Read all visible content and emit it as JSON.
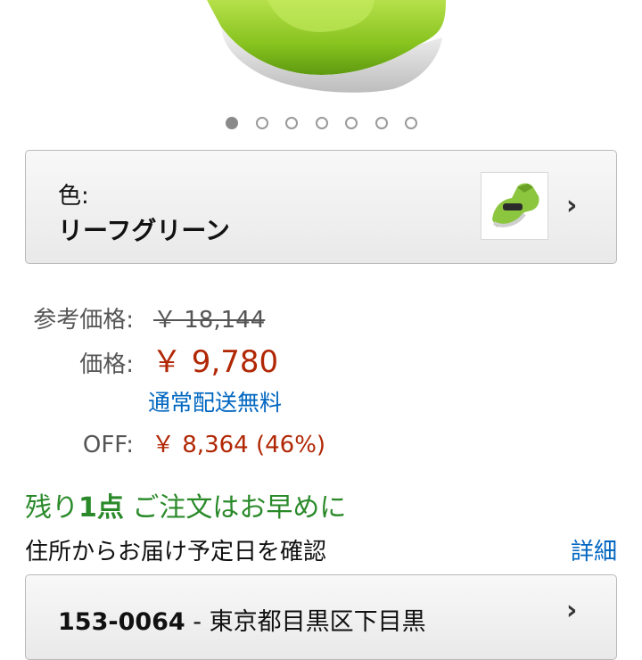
{
  "product_image": {
    "icon": "vacuum-cleaner-icon",
    "color": "#8cc63f"
  },
  "carousel": {
    "count": 7,
    "active_index": 0
  },
  "variant": {
    "label": "色:",
    "value": "リーフグリーン",
    "thumb_icon": "vacuum-thumbnail-icon"
  },
  "pricing": {
    "list_price_label": "参考価格:",
    "list_price": "￥ 18,144",
    "price_label": "価格:",
    "price": "￥ 9,780",
    "shipping": "通常配送無料",
    "off_label": "OFF:",
    "off_value": "￥ 8,364 (46%)"
  },
  "stock": {
    "prefix": "残り",
    "count": "1点",
    "suffix": " ご注文はお早めに"
  },
  "delivery": {
    "text": "住所からお届け予定日を確認",
    "details_link": "詳細"
  },
  "address": {
    "zip": "153-0064",
    "separator": " - ",
    "location": "東京都目黒区下目黒"
  },
  "colors": {
    "price_red": "#b12704",
    "link_blue": "#0066c0",
    "stock_green": "#2a8a2a"
  }
}
